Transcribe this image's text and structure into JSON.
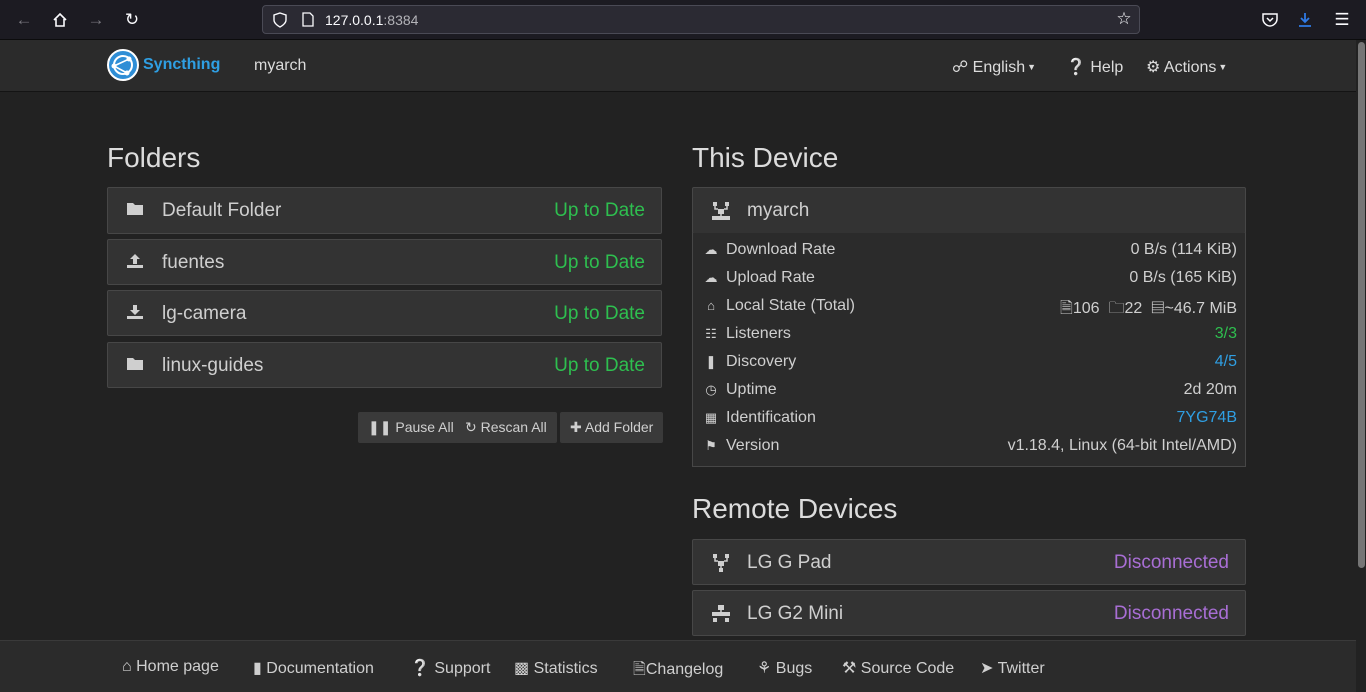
{
  "browser": {
    "url_host": "127.0.0.1",
    "url_port": ":8384"
  },
  "navbar": {
    "brand": "Syncthing",
    "device_name": "myarch",
    "language": "English",
    "help": "Help",
    "actions": "Actions"
  },
  "folders": {
    "heading": "Folders",
    "items": [
      {
        "name": "Default Folder",
        "status": "Up to Date",
        "icon": "folder-icon"
      },
      {
        "name": "fuentes",
        "status": "Up to Date",
        "icon": "upload-icon"
      },
      {
        "name": "lg-camera",
        "status": "Up to Date",
        "icon": "download-icon"
      },
      {
        "name": "linux-guides",
        "status": "Up to Date",
        "icon": "folder-icon"
      }
    ],
    "buttons": {
      "pause_all": "Pause All",
      "rescan_all": "Rescan All",
      "add_folder": "Add Folder"
    }
  },
  "this_device": {
    "heading": "This Device",
    "name": "myarch",
    "rows": [
      {
        "label": "Download Rate",
        "value": "0 B/s (114 KiB)",
        "icon": "cloud-download-icon"
      },
      {
        "label": "Upload Rate",
        "value": "0 B/s (165 KiB)",
        "icon": "cloud-upload-icon"
      },
      {
        "label": "Local State (Total)",
        "value": "",
        "icon": "home-icon"
      },
      {
        "label": "Listeners",
        "value": "3/3",
        "icon": "sitemap-icon"
      },
      {
        "label": "Discovery",
        "value": "4/5",
        "icon": "signpost-icon"
      },
      {
        "label": "Uptime",
        "value": "2d 20m",
        "icon": "clock-icon"
      },
      {
        "label": "Identification",
        "value": "7YG74B",
        "icon": "qrcode-icon"
      },
      {
        "label": "Version",
        "value": "v1.18.4, Linux (64-bit Intel/AMD)",
        "icon": "tag-icon"
      }
    ],
    "local_state": {
      "files": "106",
      "dirs": "22",
      "size": "~46.7 MiB"
    }
  },
  "remote_devices": {
    "heading": "Remote Devices",
    "items": [
      {
        "name": "LG G Pad",
        "status": "Disconnected"
      },
      {
        "name": "LG G2 Mini",
        "status": "Disconnected"
      }
    ]
  },
  "footer": {
    "links": [
      "Home page",
      "Documentation",
      "Support",
      "Statistics",
      "Changelog",
      "Bugs",
      "Source Code",
      "Twitter"
    ]
  },
  "colors": {
    "up_to_date": "#2ebf4f",
    "disconnected": "#a86ed4",
    "link_blue": "#2f9fe3"
  }
}
